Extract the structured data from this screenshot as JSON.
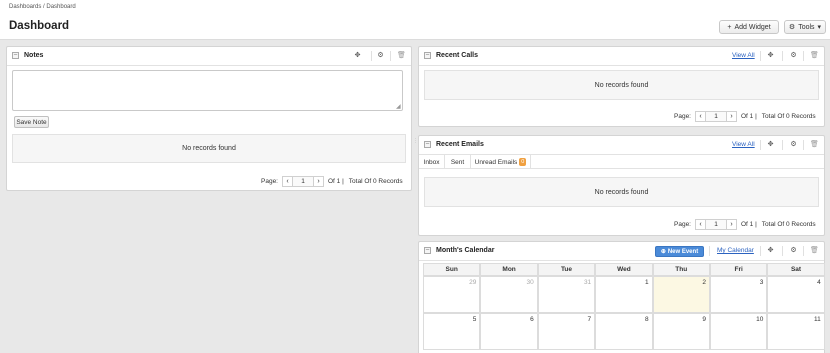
{
  "breadcrumb": {
    "items": [
      "Dashboards",
      "Dashboard"
    ],
    "separator": "/"
  },
  "header": {
    "title": "Dashboard",
    "add_widget": "Add Widget",
    "tools": "Tools"
  },
  "notes": {
    "title": "Notes",
    "textarea_value": "",
    "save_label": "Save Note",
    "empty": "No records found",
    "pager": {
      "label": "Page:",
      "page": "1",
      "of": "Of 1 |",
      "total": "Total Of 0 Records"
    }
  },
  "recent_calls": {
    "title": "Recent Calls",
    "view_all": "View All",
    "empty": "No records found",
    "pager": {
      "label": "Page:",
      "page": "1",
      "of": "Of 1 |",
      "total": "Total Of 0 Records"
    }
  },
  "recent_emails": {
    "title": "Recent Emails",
    "view_all": "View All",
    "tabs": [
      {
        "label": "Inbox"
      },
      {
        "label": "Sent"
      },
      {
        "label": "Unread Emails",
        "badge": "0"
      }
    ],
    "empty": "No records found",
    "pager": {
      "label": "Page:",
      "page": "1",
      "of": "Of 1 |",
      "total": "Total Of 0 Records"
    }
  },
  "calendar": {
    "title": "Month's Calendar",
    "new_event": "New Event",
    "my_calendar": "My Calendar",
    "days": [
      "Sun",
      "Mon",
      "Tue",
      "Wed",
      "Thu",
      "Fri",
      "Sat"
    ],
    "week1": [
      "29",
      "30",
      "31",
      "1",
      "2",
      "3",
      "4"
    ],
    "week2": [
      "5",
      "6",
      "7",
      "8",
      "9",
      "10",
      "11"
    ]
  },
  "colors": {
    "link": "#2b62c0",
    "badge": "#f0a040",
    "primary_button": "#4a8ad8",
    "today": "#fcf8e3"
  }
}
